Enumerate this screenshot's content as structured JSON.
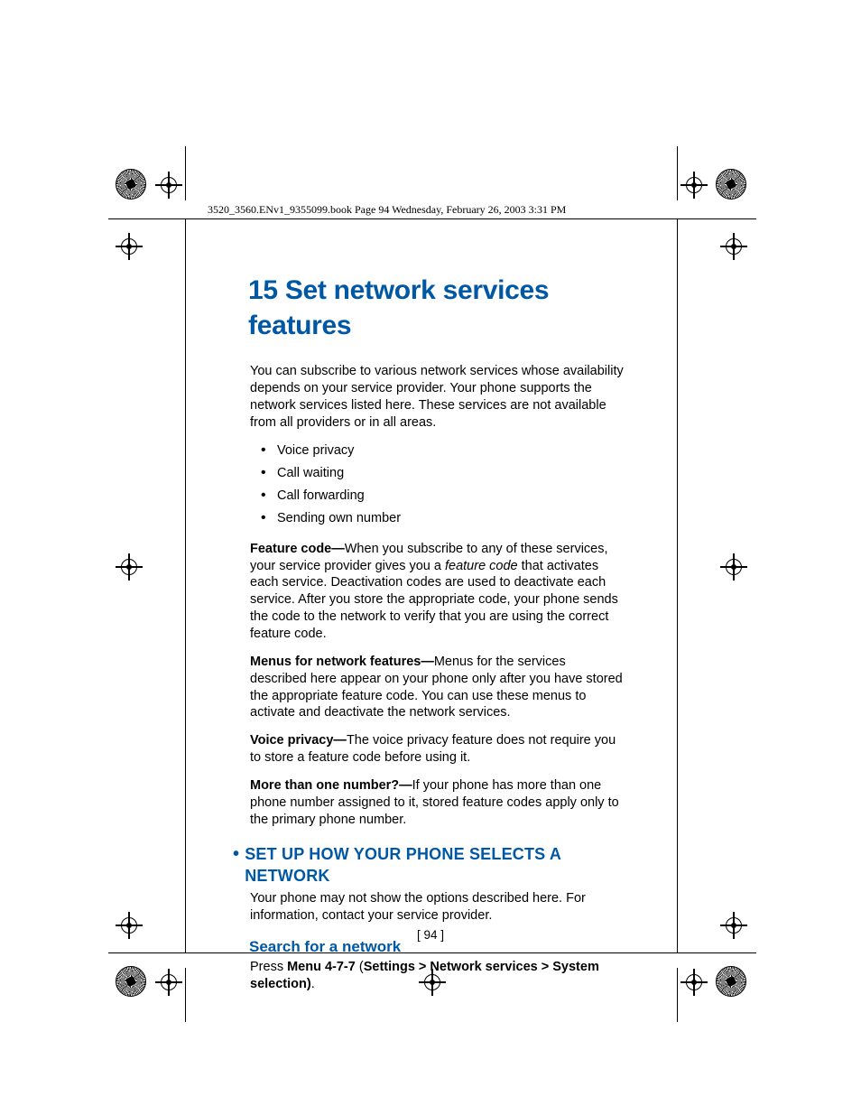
{
  "header": "3520_3560.ENv1_9355099.book  Page 94  Wednesday, February 26, 2003  3:31 PM",
  "chapter_num": "15",
  "chapter_title": "Set network services features",
  "intro": "You can subscribe to various network services whose availability depends on your service provider. Your phone supports the network services listed here. These services are not available from all providers or in all areas.",
  "bullets": [
    "Voice privacy",
    "Call waiting",
    "Call forwarding",
    "Sending own number"
  ],
  "para_fc_label": "Feature code—",
  "para_fc_pre": "When you subscribe to any of these services, your service provider gives you a ",
  "para_fc_italic": "feature code",
  "para_fc_post": " that activates each service. Deactivation codes are used to deactivate each service. After you store the appropriate code, your phone sends the code to the network to verify that you are using the correct feature code.",
  "para_menus_label": "Menus for network features—",
  "para_menus": "Menus for the services described here appear on your phone only after you have stored the appropriate feature code. You can use these menus to activate and deactivate the network services.",
  "para_voice_label": "Voice privacy—",
  "para_voice": "The voice privacy feature does not require you to store a feature code before using it.",
  "para_more_label": "More than one number?—",
  "para_more": "If your phone has more than one phone number assigned to it, stored feature codes apply only to the primary phone number.",
  "section_title": "SET UP HOW YOUR PHONE SELECTS A NETWORK",
  "section_intro": "Your phone may not show the options described here. For information, contact your service provider.",
  "sub_title": "Search for a network",
  "menu_press": "Press ",
  "menu_bold1": "Menu 4-7-7",
  "menu_paren": " (",
  "menu_bold2": "Settings > Network services > System selection)",
  "menu_end": ".",
  "page_number": "[ 94 ]"
}
